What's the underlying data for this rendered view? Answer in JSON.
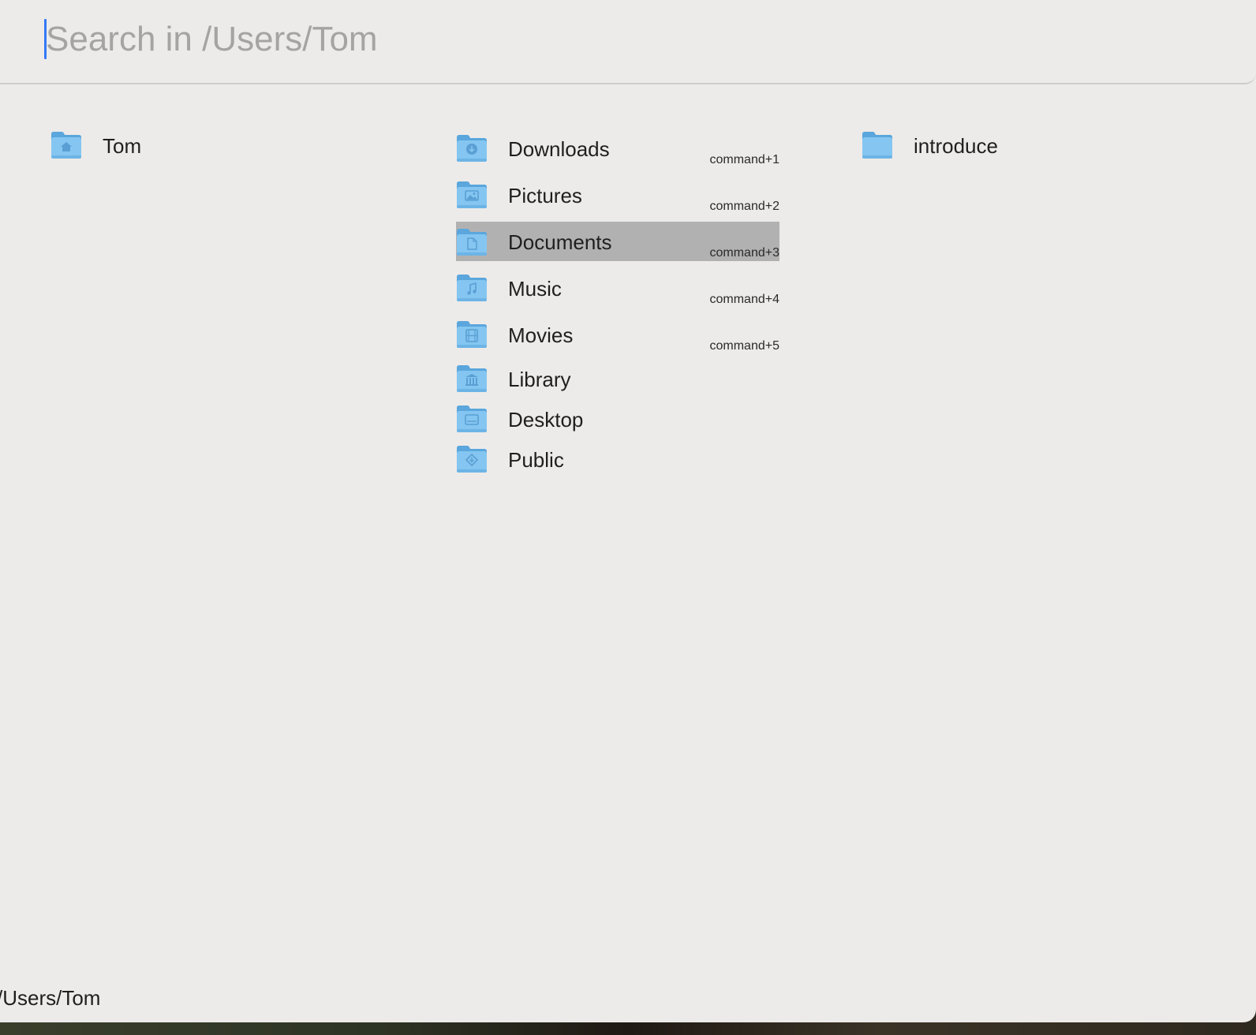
{
  "search": {
    "placeholder": "Search in /Users/Tom",
    "value": ""
  },
  "columns": {
    "parent": {
      "items": [
        {
          "label": "Tom",
          "icon": "home-folder-icon"
        }
      ]
    },
    "current": {
      "items": [
        {
          "label": "Downloads",
          "shortcut": "command+1",
          "icon": "downloads-folder-icon"
        },
        {
          "label": "Pictures",
          "shortcut": "command+2",
          "icon": "pictures-folder-icon"
        },
        {
          "label": "Documents",
          "shortcut": "command+3",
          "icon": "documents-folder-icon",
          "selected": true
        },
        {
          "label": "Music",
          "shortcut": "command+4",
          "icon": "music-folder-icon"
        },
        {
          "label": "Movies",
          "shortcut": "command+5",
          "icon": "movies-folder-icon"
        },
        {
          "label": "Library",
          "icon": "library-folder-icon"
        },
        {
          "label": "Desktop",
          "icon": "desktop-folder-icon"
        },
        {
          "label": "Public",
          "icon": "public-folder-icon"
        }
      ]
    },
    "preview": {
      "items": [
        {
          "label": "introduce",
          "icon": "folder-icon"
        }
      ]
    }
  },
  "footer": {
    "path": "/Users/Tom"
  },
  "colors": {
    "panel_background": "#edebe9",
    "selection": "#b2b1b2",
    "caret": "#3478f6",
    "folder_body": "#7fc3f0",
    "folder_tab": "#5aa6dd"
  }
}
